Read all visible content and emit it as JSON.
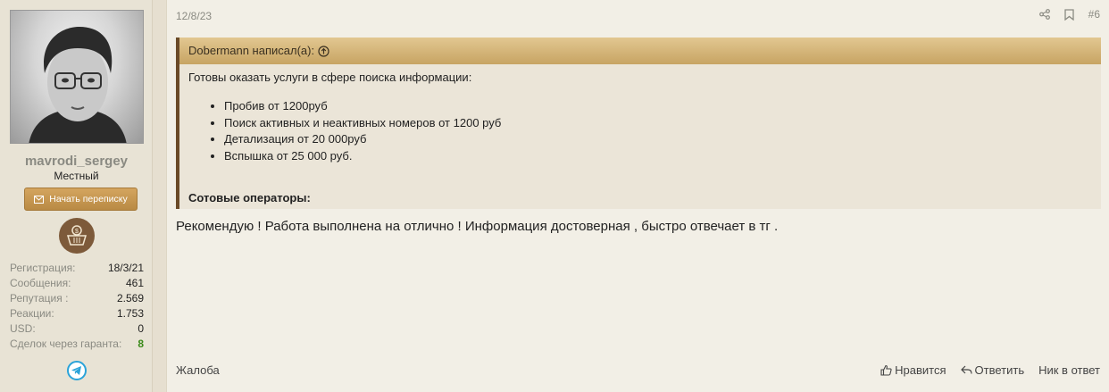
{
  "user": {
    "username": "mavrodi_sergey",
    "title": "Местный",
    "start_conversation": "Начать переписку",
    "stats": [
      {
        "label": "Регистрация:",
        "value": "18/3/21"
      },
      {
        "label": "Сообщения:",
        "value": "461"
      },
      {
        "label": "Репутация :",
        "value": "2.569"
      },
      {
        "label": "Реакции:",
        "value": "1.753"
      },
      {
        "label": "USD:",
        "value": "0"
      },
      {
        "label": "Сделок через гаранта:",
        "value": "8"
      }
    ],
    "colors": {
      "username": "#8a8a82",
      "deals": "#3a8a1a"
    }
  },
  "post": {
    "date": "12/8/23",
    "number": "#6",
    "quote": {
      "author_line": "Dobermann написал(а):",
      "intro": "Готовы оказать услуги в сфере поиска информации:",
      "items": [
        "Пробив от 1200руб",
        "Поиск активных и неактивных номеров от 1200 руб",
        "Детализация от 20 000руб",
        "Вспышка от 25 000 руб."
      ],
      "subheading": "Сотовые операторы:"
    },
    "text": "Рекомендую ! Работа выполнена на отлично ! Информация достоверная , быстро отвечает в тг .",
    "footer": {
      "report": "Жалоба",
      "like": "Нравится",
      "reply": "Ответить",
      "nick": "Ник в ответ"
    }
  },
  "icons": [
    "share-icon",
    "bookmark-icon",
    "arrow-up-circle-icon",
    "envelope-icon",
    "basket-badge-icon",
    "telegram-icon",
    "thumbs-up-icon",
    "reply-icon"
  ],
  "accent": "#c7a463"
}
